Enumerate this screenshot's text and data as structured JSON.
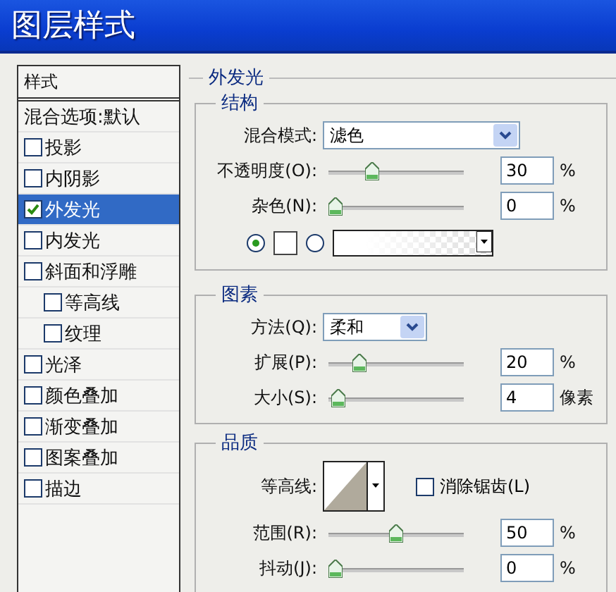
{
  "window": {
    "title": "图层样式"
  },
  "styles": {
    "header": "样式",
    "blend_options": "混合选项:默认",
    "items": [
      {
        "label": "投影",
        "checked": false,
        "selected": false
      },
      {
        "label": "内阴影",
        "checked": false,
        "selected": false
      },
      {
        "label": "外发光",
        "checked": true,
        "selected": true
      },
      {
        "label": "内发光",
        "checked": false,
        "selected": false
      },
      {
        "label": "斜面和浮雕",
        "checked": false,
        "selected": false,
        "children": [
          {
            "label": "等高线",
            "checked": false,
            "selected": false
          },
          {
            "label": "纹理",
            "checked": false,
            "selected": false
          }
        ]
      },
      {
        "label": "光泽",
        "checked": false,
        "selected": false
      },
      {
        "label": "颜色叠加",
        "checked": false,
        "selected": false
      },
      {
        "label": "渐变叠加",
        "checked": false,
        "selected": false
      },
      {
        "label": "图案叠加",
        "checked": false,
        "selected": false
      },
      {
        "label": "描边",
        "checked": false,
        "selected": false
      }
    ]
  },
  "panel": {
    "title": "外发光",
    "structure": {
      "title": "结构",
      "blend_mode": {
        "label": "混合模式:",
        "value": "滤色"
      },
      "sliders": [
        {
          "label": "不透明度(O):",
          "level": 0.3,
          "value": "30",
          "unit": "%"
        },
        {
          "label": "杂色(N):",
          "level": 0,
          "value": "0",
          "unit": "%"
        }
      ],
      "fill": [
        {
          "kind": "color",
          "selected": true
        },
        {
          "kind": "gradient",
          "selected": false
        }
      ]
    },
    "elements": {
      "title": "图素",
      "technique": {
        "label": "方法(Q):",
        "value": "柔和"
      },
      "sliders": [
        {
          "label": "扩展(P):",
          "level": 0.2,
          "value": "20",
          "unit": "%"
        },
        {
          "label": "大小(S):",
          "level": 0.02,
          "value": "4",
          "unit": "像素"
        }
      ]
    },
    "quality": {
      "title": "品质",
      "contour_label": "等高线:",
      "anti_alias": {
        "label": "消除锯齿(L)",
        "checked": false
      },
      "sliders": [
        {
          "label": "范围(R):",
          "level": 0.5,
          "value": "50",
          "unit": "%"
        },
        {
          "label": "抖动(J):",
          "level": 0,
          "value": "0",
          "unit": "%"
        }
      ]
    }
  }
}
